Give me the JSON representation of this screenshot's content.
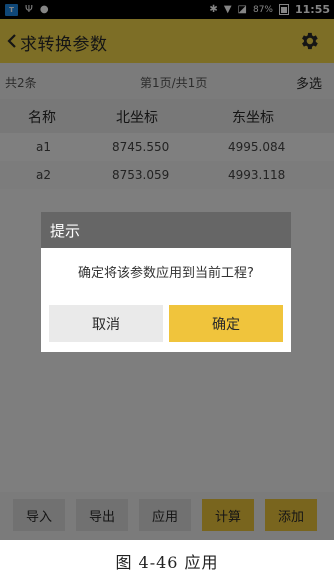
{
  "status_bar": {
    "app_icon": "app-icon",
    "usb_glyph": "Ψ",
    "android_glyph": "●",
    "bluetooth_glyph": "✱",
    "wifi_glyph": "▼",
    "signal_glyph": "◪",
    "battery_text": "87%",
    "time": "11:55"
  },
  "titlebar": {
    "title": "求转换参数",
    "settings_icon": "gear-icon",
    "back_icon": "chevron-left-icon",
    "color": "#f0d44a"
  },
  "info_row": {
    "record_count": "共2条",
    "page_info": "第1页/共1页",
    "multi_select": "多选"
  },
  "table": {
    "columns": [
      "名称",
      "北坐标",
      "东坐标"
    ],
    "rows": [
      [
        "a1",
        "8745.550",
        "4995.084"
      ],
      [
        "a2",
        "8753.059",
        "4993.118"
      ]
    ]
  },
  "dialog": {
    "title": "提示",
    "message": "确定将该参数应用到当前工程?",
    "cancel_label": "取消",
    "confirm_label": "确定",
    "confirm_color": "#f0c43c"
  },
  "toolbar": {
    "import_label": "导入",
    "export_label": "导出",
    "apply_label": "应用",
    "calculate_label": "计算",
    "add_label": "添加",
    "accent_color": "#e9c23b"
  },
  "caption": "图 4-46 应用"
}
